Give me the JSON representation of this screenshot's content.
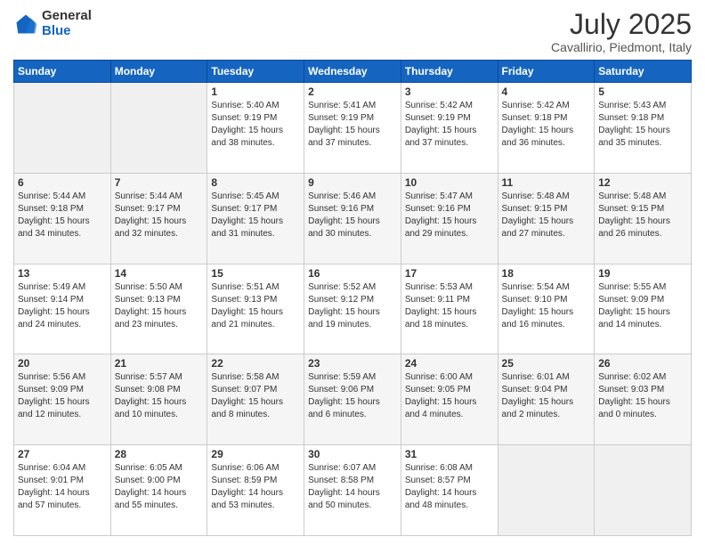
{
  "header": {
    "logo": {
      "general": "General",
      "blue": "Blue"
    },
    "title": "July 2025",
    "subtitle": "Cavallirio, Piedmont, Italy"
  },
  "days_of_week": [
    "Sunday",
    "Monday",
    "Tuesday",
    "Wednesday",
    "Thursday",
    "Friday",
    "Saturday"
  ],
  "weeks": [
    [
      null,
      null,
      {
        "day": 1,
        "sunrise": "5:40 AM",
        "sunset": "9:19 PM",
        "daylight": "15 hours and 38 minutes."
      },
      {
        "day": 2,
        "sunrise": "5:41 AM",
        "sunset": "9:19 PM",
        "daylight": "15 hours and 37 minutes."
      },
      {
        "day": 3,
        "sunrise": "5:42 AM",
        "sunset": "9:19 PM",
        "daylight": "15 hours and 37 minutes."
      },
      {
        "day": 4,
        "sunrise": "5:42 AM",
        "sunset": "9:18 PM",
        "daylight": "15 hours and 36 minutes."
      },
      {
        "day": 5,
        "sunrise": "5:43 AM",
        "sunset": "9:18 PM",
        "daylight": "15 hours and 35 minutes."
      }
    ],
    [
      {
        "day": 6,
        "sunrise": "5:44 AM",
        "sunset": "9:18 PM",
        "daylight": "15 hours and 34 minutes."
      },
      {
        "day": 7,
        "sunrise": "5:44 AM",
        "sunset": "9:17 PM",
        "daylight": "15 hours and 32 minutes."
      },
      {
        "day": 8,
        "sunrise": "5:45 AM",
        "sunset": "9:17 PM",
        "daylight": "15 hours and 31 minutes."
      },
      {
        "day": 9,
        "sunrise": "5:46 AM",
        "sunset": "9:16 PM",
        "daylight": "15 hours and 30 minutes."
      },
      {
        "day": 10,
        "sunrise": "5:47 AM",
        "sunset": "9:16 PM",
        "daylight": "15 hours and 29 minutes."
      },
      {
        "day": 11,
        "sunrise": "5:48 AM",
        "sunset": "9:15 PM",
        "daylight": "15 hours and 27 minutes."
      },
      {
        "day": 12,
        "sunrise": "5:48 AM",
        "sunset": "9:15 PM",
        "daylight": "15 hours and 26 minutes."
      }
    ],
    [
      {
        "day": 13,
        "sunrise": "5:49 AM",
        "sunset": "9:14 PM",
        "daylight": "15 hours and 24 minutes."
      },
      {
        "day": 14,
        "sunrise": "5:50 AM",
        "sunset": "9:13 PM",
        "daylight": "15 hours and 23 minutes."
      },
      {
        "day": 15,
        "sunrise": "5:51 AM",
        "sunset": "9:13 PM",
        "daylight": "15 hours and 21 minutes."
      },
      {
        "day": 16,
        "sunrise": "5:52 AM",
        "sunset": "9:12 PM",
        "daylight": "15 hours and 19 minutes."
      },
      {
        "day": 17,
        "sunrise": "5:53 AM",
        "sunset": "9:11 PM",
        "daylight": "15 hours and 18 minutes."
      },
      {
        "day": 18,
        "sunrise": "5:54 AM",
        "sunset": "9:10 PM",
        "daylight": "15 hours and 16 minutes."
      },
      {
        "day": 19,
        "sunrise": "5:55 AM",
        "sunset": "9:09 PM",
        "daylight": "15 hours and 14 minutes."
      }
    ],
    [
      {
        "day": 20,
        "sunrise": "5:56 AM",
        "sunset": "9:09 PM",
        "daylight": "15 hours and 12 minutes."
      },
      {
        "day": 21,
        "sunrise": "5:57 AM",
        "sunset": "9:08 PM",
        "daylight": "15 hours and 10 minutes."
      },
      {
        "day": 22,
        "sunrise": "5:58 AM",
        "sunset": "9:07 PM",
        "daylight": "15 hours and 8 minutes."
      },
      {
        "day": 23,
        "sunrise": "5:59 AM",
        "sunset": "9:06 PM",
        "daylight": "15 hours and 6 minutes."
      },
      {
        "day": 24,
        "sunrise": "6:00 AM",
        "sunset": "9:05 PM",
        "daylight": "15 hours and 4 minutes."
      },
      {
        "day": 25,
        "sunrise": "6:01 AM",
        "sunset": "9:04 PM",
        "daylight": "15 hours and 2 minutes."
      },
      {
        "day": 26,
        "sunrise": "6:02 AM",
        "sunset": "9:03 PM",
        "daylight": "15 hours and 0 minutes."
      }
    ],
    [
      {
        "day": 27,
        "sunrise": "6:04 AM",
        "sunset": "9:01 PM",
        "daylight": "14 hours and 57 minutes."
      },
      {
        "day": 28,
        "sunrise": "6:05 AM",
        "sunset": "9:00 PM",
        "daylight": "14 hours and 55 minutes."
      },
      {
        "day": 29,
        "sunrise": "6:06 AM",
        "sunset": "8:59 PM",
        "daylight": "14 hours and 53 minutes."
      },
      {
        "day": 30,
        "sunrise": "6:07 AM",
        "sunset": "8:58 PM",
        "daylight": "14 hours and 50 minutes."
      },
      {
        "day": 31,
        "sunrise": "6:08 AM",
        "sunset": "8:57 PM",
        "daylight": "14 hours and 48 minutes."
      },
      null,
      null
    ]
  ],
  "labels": {
    "sunrise": "Sunrise:",
    "sunset": "Sunset:",
    "daylight": "Daylight:"
  },
  "colors": {
    "header_bg": "#1565c0",
    "header_text": "#ffffff"
  }
}
